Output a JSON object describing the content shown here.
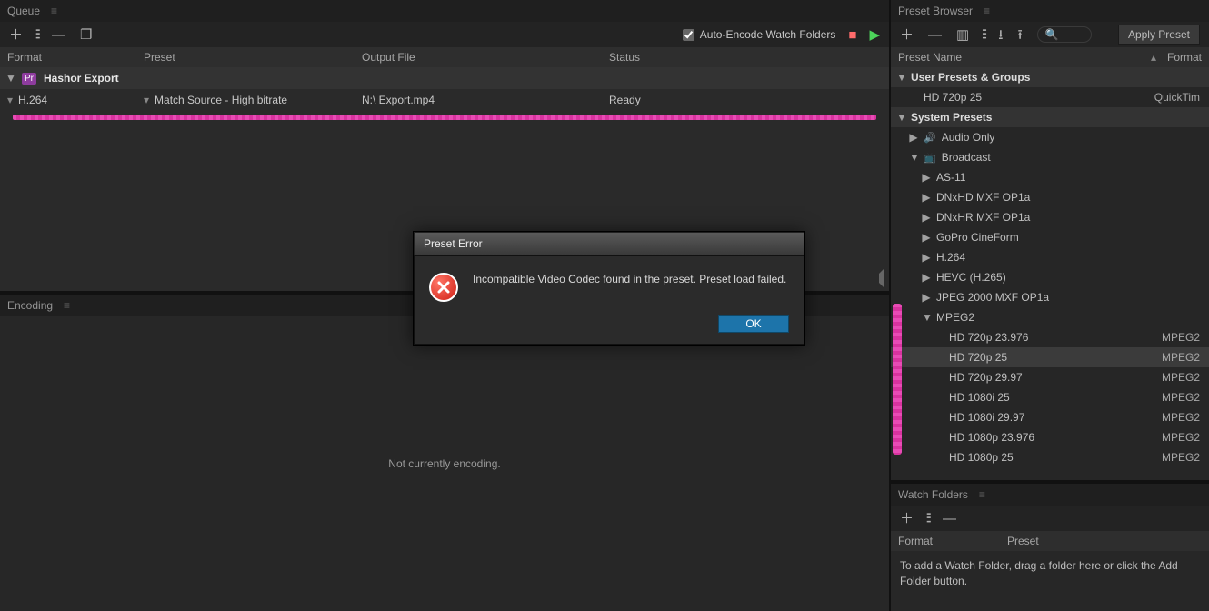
{
  "queue": {
    "panel_title": "Queue",
    "toolbar": {
      "auto_encode_label": "Auto-Encode Watch Folders",
      "auto_encode_checked": true
    },
    "columns": {
      "format": "Format",
      "preset": "Preset",
      "output": "Output File",
      "status": "Status"
    },
    "group": {
      "title": "Hashor Export"
    },
    "row": {
      "format": "H.264",
      "preset": "Match Source - High bitrate",
      "output": "N:\\  Export.mp4",
      "status": "Ready"
    }
  },
  "encoding": {
    "panel_title": "Encoding",
    "message": "Not currently encoding."
  },
  "preset_browser": {
    "panel_title": "Preset Browser",
    "apply_label": "Apply Preset",
    "columns": {
      "name": "Preset Name",
      "format": "Format"
    },
    "user_group": "User Presets & Groups",
    "user_items": [
      {
        "label": "HD 720p 25",
        "format": "QuickTim"
      }
    ],
    "system_group": "System Presets",
    "categories": [
      {
        "label": "Audio Only",
        "expanded": false,
        "icon": "speaker"
      },
      {
        "label": "Broadcast",
        "expanded": true,
        "icon": "tv",
        "children": [
          {
            "label": "AS-11"
          },
          {
            "label": "DNxHD MXF OP1a"
          },
          {
            "label": "DNxHR MXF OP1a"
          },
          {
            "label": "GoPro CineForm"
          },
          {
            "label": "H.264"
          },
          {
            "label": "HEVC (H.265)"
          },
          {
            "label": "JPEG 2000 MXF OP1a"
          },
          {
            "label": "MPEG2",
            "expanded": true,
            "presets": [
              {
                "label": "HD 720p 23.976",
                "format": "MPEG2"
              },
              {
                "label": "HD 720p 25",
                "format": "MPEG2",
                "selected": true
              },
              {
                "label": "HD 720p 29.97",
                "format": "MPEG2"
              },
              {
                "label": "HD 1080i 25",
                "format": "MPEG2"
              },
              {
                "label": "HD 1080i 29.97",
                "format": "MPEG2"
              },
              {
                "label": "HD 1080p 23.976",
                "format": "MPEG2"
              },
              {
                "label": "HD 1080p 25",
                "format": "MPEG2"
              }
            ]
          }
        ]
      }
    ]
  },
  "watch_folders": {
    "panel_title": "Watch Folders",
    "columns": {
      "format": "Format",
      "preset": "Preset"
    },
    "hint": "To add a Watch Folder, drag a folder here or click the Add Folder button."
  },
  "modal": {
    "title": "Preset Error",
    "message": "Incompatible Video Codec found in the preset. Preset load failed.",
    "ok_label": "OK"
  }
}
